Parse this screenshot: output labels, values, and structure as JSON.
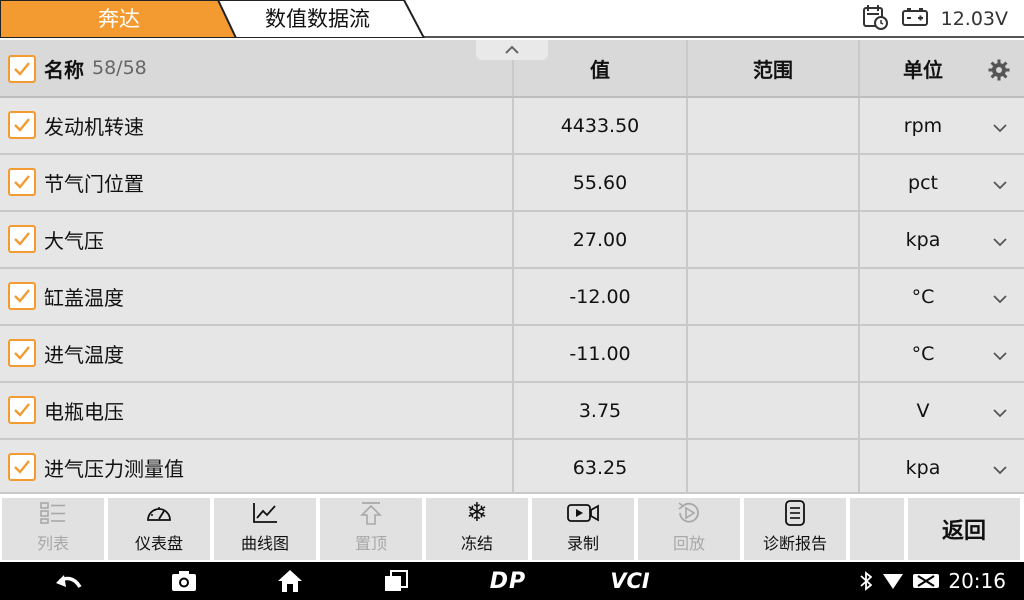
{
  "header": {
    "breadcrumb_brand": "奔达",
    "breadcrumb_page": "数值数据流",
    "voltage": "12.03V",
    "accent_color": "#f39b31"
  },
  "table": {
    "columns": {
      "name": "名称",
      "count": "58/58",
      "value": "值",
      "range": "范围",
      "unit": "单位"
    },
    "rows": [
      {
        "name": "发动机转速",
        "value": "4433.50",
        "range": "",
        "unit": "rpm"
      },
      {
        "name": "节气门位置",
        "value": "55.60",
        "range": "",
        "unit": "pct"
      },
      {
        "name": "大气压",
        "value": "27.00",
        "range": "",
        "unit": "kpa"
      },
      {
        "name": "缸盖温度",
        "value": "-12.00",
        "range": "",
        "unit": "°C"
      },
      {
        "name": "进气温度",
        "value": "-11.00",
        "range": "",
        "unit": "°C"
      },
      {
        "name": "电瓶电压",
        "value": "3.75",
        "range": "",
        "unit": "V"
      },
      {
        "name": "进气压力测量值",
        "value": "63.25",
        "range": "",
        "unit": "kpa"
      }
    ]
  },
  "toolbar": {
    "list": "列表",
    "dashboard": "仪表盘",
    "graph": "曲线图",
    "top": "置顶",
    "freeze": "冻结",
    "record": "录制",
    "playback": "回放",
    "report": "诊断报告",
    "back": "返回"
  },
  "navbar": {
    "brand1": "DP",
    "brand2": "VCI",
    "time": "20:16"
  }
}
